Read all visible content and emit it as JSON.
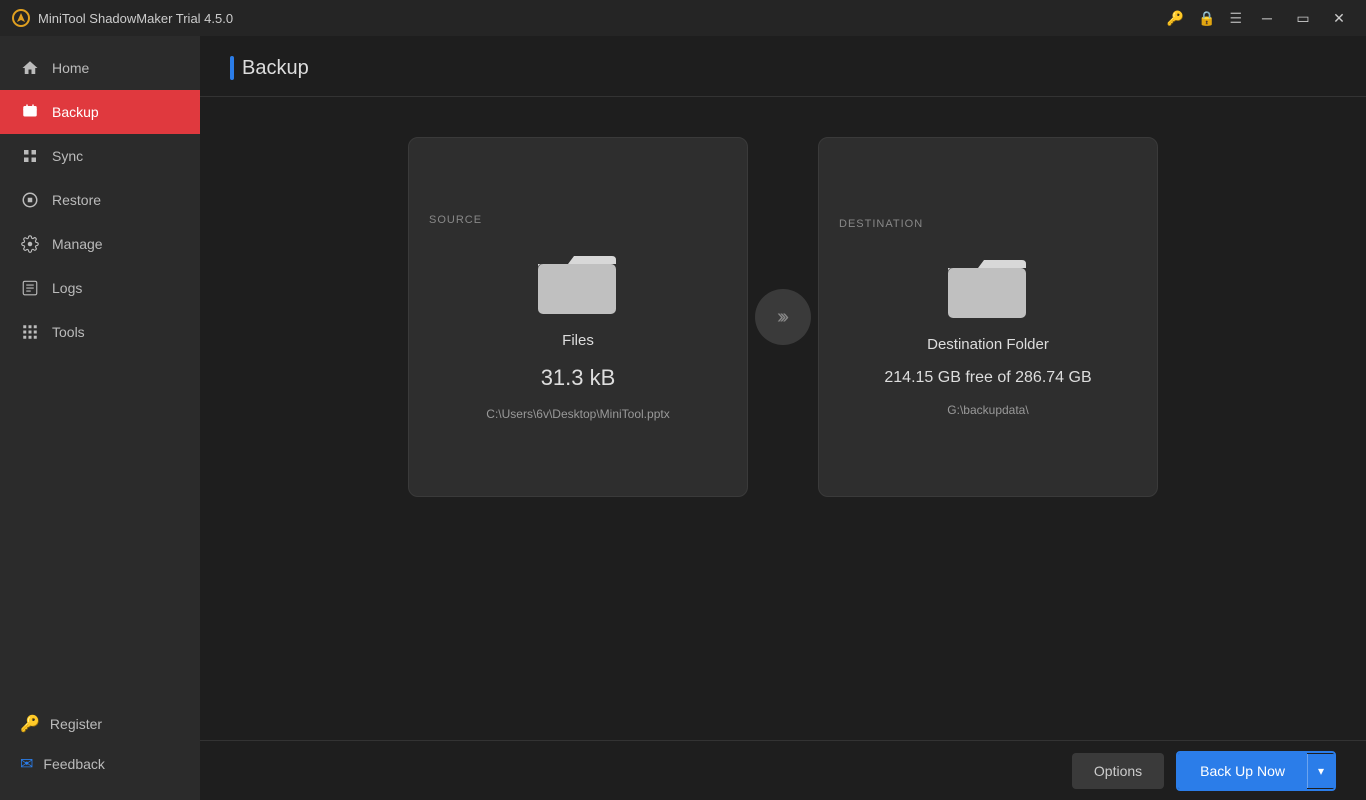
{
  "titleBar": {
    "appTitle": "MiniTool ShadowMaker Trial 4.5.0"
  },
  "sidebar": {
    "items": [
      {
        "id": "home",
        "label": "Home",
        "active": false
      },
      {
        "id": "backup",
        "label": "Backup",
        "active": true
      },
      {
        "id": "sync",
        "label": "Sync",
        "active": false
      },
      {
        "id": "restore",
        "label": "Restore",
        "active": false
      },
      {
        "id": "manage",
        "label": "Manage",
        "active": false
      },
      {
        "id": "logs",
        "label": "Logs",
        "active": false
      },
      {
        "id": "tools",
        "label": "Tools",
        "active": false
      }
    ],
    "bottomItems": [
      {
        "id": "register",
        "label": "Register"
      },
      {
        "id": "feedback",
        "label": "Feedback"
      }
    ]
  },
  "page": {
    "title": "Backup"
  },
  "source": {
    "label": "SOURCE",
    "icon": "folder",
    "name": "Files",
    "size": "31.3 kB",
    "path": "C:\\Users\\6v\\Desktop\\MiniTool.pptx"
  },
  "destination": {
    "label": "DESTINATION",
    "icon": "folder",
    "name": "Destination Folder",
    "freeSpace": "214.15 GB free of 286.74 GB",
    "path": "G:\\backupdata\\"
  },
  "buttons": {
    "options": "Options",
    "backupNow": "Back Up Now",
    "dropdownArrow": "▾"
  }
}
